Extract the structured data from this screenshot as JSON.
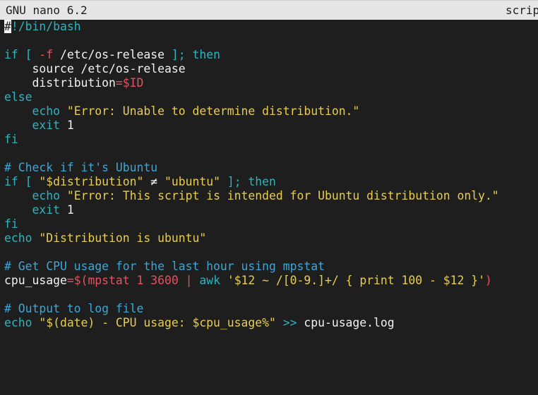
{
  "titlebar": {
    "app": "GNU nano 6.2",
    "filename": "scrip"
  },
  "editor": {
    "cursor_char": "#",
    "shebang_rest": "!/bin/bash",
    "l3": {
      "if": "if",
      "bracket_open": " [ ",
      "flag": "-f",
      "path": " /etc/os-release ",
      "bracket_close": "];",
      "then": " then"
    },
    "l4": {
      "indent": "    ",
      "text": "source /etc/os-release"
    },
    "l5": {
      "indent": "    ",
      "name": "distribution",
      "eq": "=",
      "var": "$ID"
    },
    "l6": {
      "else": "else"
    },
    "l7": {
      "indent": "    ",
      "echo": "echo",
      "str": " \"Error: Unable to determine distribution.\""
    },
    "l8": {
      "indent": "    ",
      "exit": "exit",
      "code": " 1"
    },
    "l9": {
      "fi": "fi"
    },
    "l11": {
      "comment": "# Check if it's Ubuntu"
    },
    "l12": {
      "if": "if",
      "bracket_open": " [ ",
      "str1": "\"$distribution\"",
      "op": " ≠ ",
      "str2": "\"ubuntu\"",
      "bracket_close": " ];",
      "then": " then"
    },
    "l13": {
      "indent": "    ",
      "echo": "echo",
      "str": " \"Error: This script is intended for Ubuntu distribution only.\""
    },
    "l14": {
      "indent": "    ",
      "exit": "exit",
      "code": " 1"
    },
    "l15": {
      "fi": "fi"
    },
    "l16": {
      "echo": "echo",
      "str": " \"Distribution is ubuntu\""
    },
    "l18": {
      "comment": "# Get CPU usage for the last hour using mpstat"
    },
    "l19": {
      "name": "cpu_usage",
      "eq": "=",
      "subst_open": "$(",
      "cmd": "mpstat 1 3600",
      "pipe": " | ",
      "awk": "awk",
      "awk_script": " '$12 ~ /[0-9.]+/ { print 100 - $12 }'",
      "subst_close": ")"
    },
    "l21": {
      "comment": "# Output to log file"
    },
    "l22": {
      "echo": "echo",
      "str": " \"$(date) - CPU usage: $cpu_usage%\"",
      "redir": " >>",
      "file": " cpu-usage.log"
    }
  },
  "colors": {
    "background": "#1e1e1e",
    "titlebar": "#e6e6e6",
    "keyword": "#2fb3bd",
    "string": "#e7cd4f",
    "variable": "#e3535f",
    "comment": "#3aa7d6",
    "text": "#f2f2f2"
  }
}
